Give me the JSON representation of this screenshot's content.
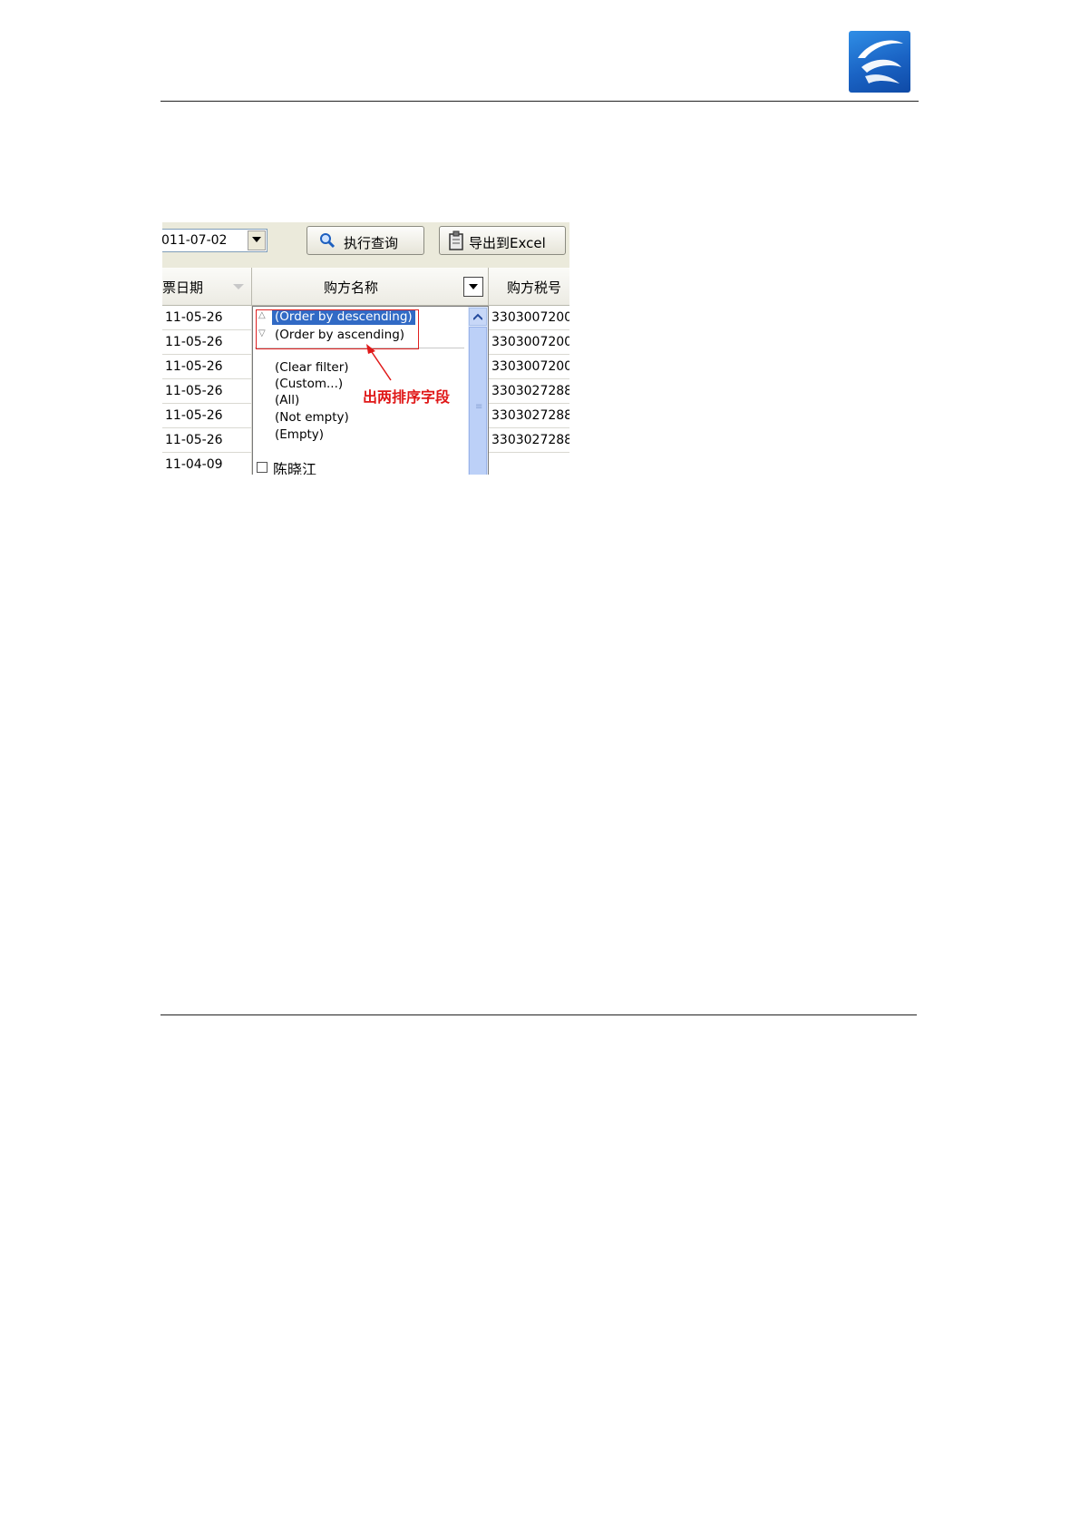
{
  "toolbar": {
    "date_value": "011-07-02",
    "query_button": "执行查询",
    "export_button": "导出到Excel"
  },
  "grid": {
    "columns": [
      "票日期",
      "购方名称",
      "购方税号"
    ],
    "date_cells": [
      "11-05-26",
      "11-05-26",
      "11-05-26",
      "11-05-26",
      "11-05-26",
      "11-05-26",
      "11-04-09"
    ],
    "taxid_cells": [
      "3303007200",
      "3303007200",
      "3303007200",
      "3303027288",
      "3303027288",
      "3303027288"
    ]
  },
  "dropdown": {
    "sort_desc": "(Order by descending)",
    "sort_asc": "(Order by ascending)",
    "clear_filter": "(Clear filter)",
    "custom": "(Custom...)",
    "all": "(All)",
    "not_empty": "(Not empty)",
    "empty": "(Empty)",
    "value_1": "陈晓江"
  },
  "annotation": {
    "text": "出两排序字段",
    "color": "#e01818"
  },
  "colors": {
    "selection": "#316ac5",
    "logo": "#1a63c4"
  }
}
